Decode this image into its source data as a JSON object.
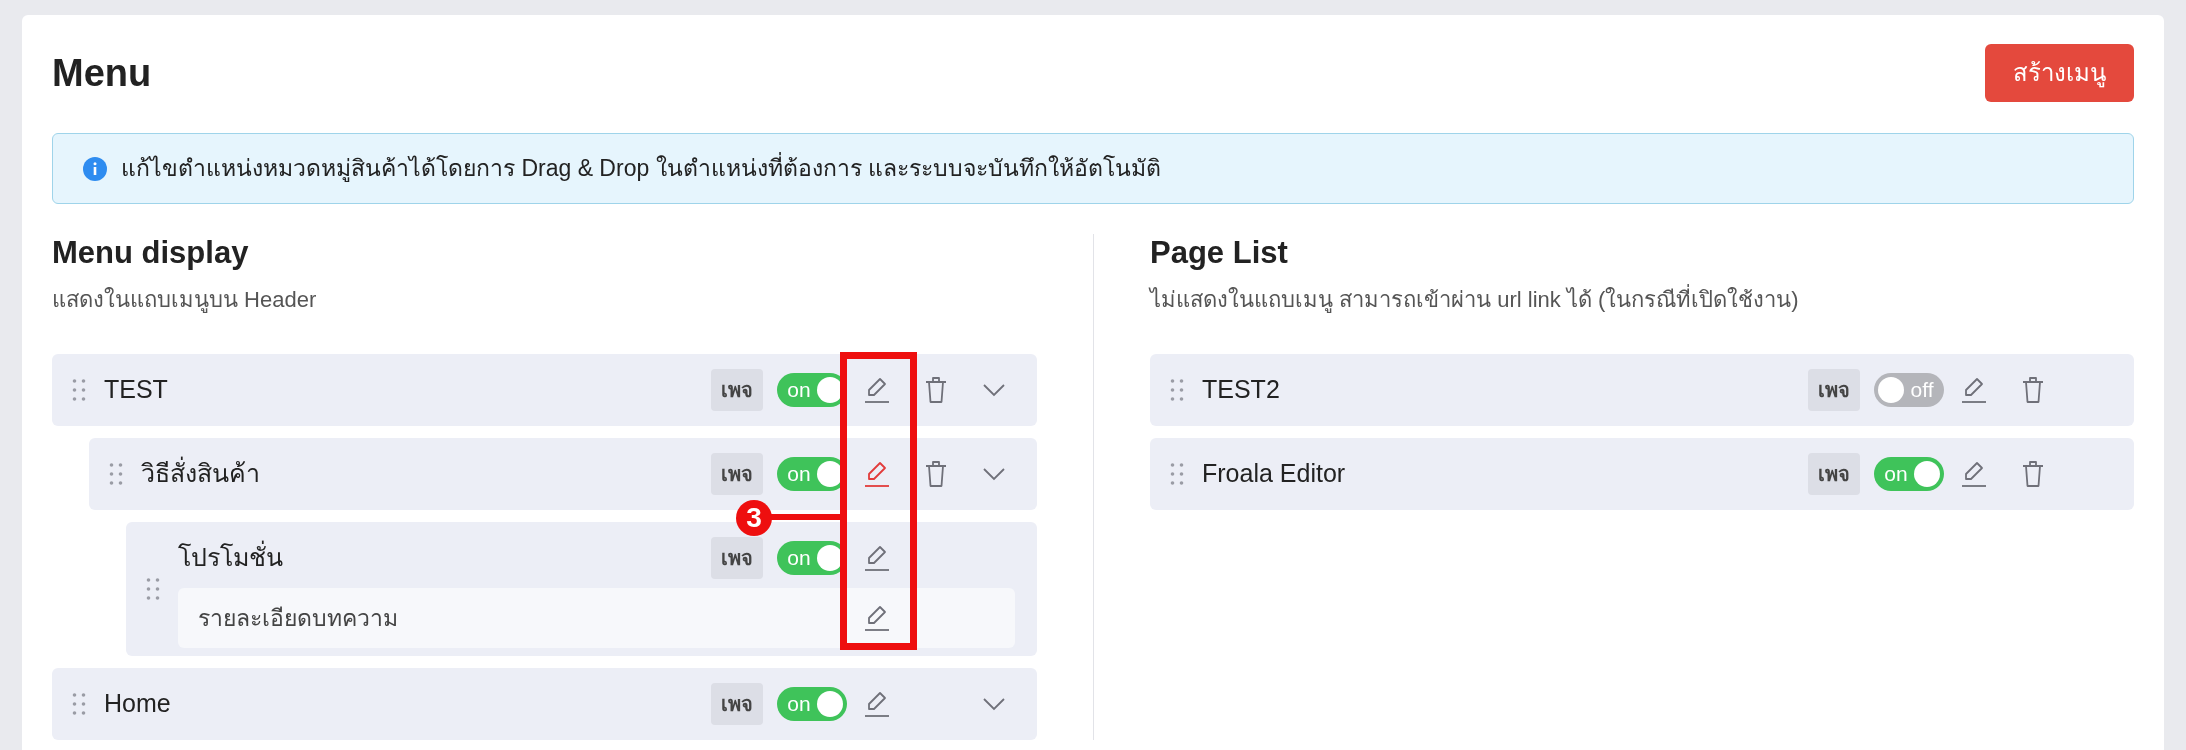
{
  "header": {
    "title": "Menu",
    "create_button": "สร้างเมนู"
  },
  "info": "แก้ไขตำแหน่งหมวดหมู่สินค้าได้โดยการ Drag & Drop ในตำแหน่งที่ต้องการ และระบบจะบันทึกให้อัตโนมัติ",
  "menu_display": {
    "title": "Menu display",
    "subtitle": "แสดงในแถบเมนูบน Header",
    "items": [
      {
        "kind": "menu",
        "label": "TEST",
        "badge": "เพจ",
        "on": true,
        "toggle_label": "on",
        "edit_highlighted": false,
        "delete": true,
        "expandable": true,
        "children": [
          {
            "kind": "menu",
            "label": "วิธีสั่งสินค้า",
            "badge": "เพจ",
            "on": true,
            "toggle_label": "on",
            "edit_highlighted": true,
            "delete": true,
            "expandable": true,
            "children": [
              {
                "kind": "menu",
                "label": "โปรโมชั่น",
                "badge": "เพจ",
                "on": true,
                "toggle_label": "on",
                "edit_highlighted": false,
                "delete": false,
                "expandable": false,
                "children": [
                  {
                    "kind": "article",
                    "label": "รายละเอียดบทความ",
                    "edit_highlighted": false
                  }
                ]
              }
            ]
          }
        ]
      },
      {
        "kind": "menu",
        "label": "Home",
        "badge": "เพจ",
        "on": true,
        "toggle_label": "on",
        "edit_highlighted": false,
        "delete": false,
        "expandable": true
      }
    ]
  },
  "page_list": {
    "title": "Page List",
    "subtitle": "ไม่แสดงในแถบเมนู สามารถเข้าผ่าน url link ได้ (ในกรณีที่เปิดใช้งาน)",
    "items": [
      {
        "kind": "menu",
        "label": "TEST2",
        "badge": "เพจ",
        "on": false,
        "toggle_label": "off",
        "edit_highlighted": false,
        "delete": true,
        "expandable": false
      },
      {
        "kind": "menu",
        "label": "Froala Editor",
        "badge": "เพจ",
        "on": true,
        "toggle_label": "on",
        "edit_highlighted": false,
        "delete": true,
        "expandable": false
      }
    ]
  },
  "annotation": {
    "marker": "3"
  }
}
